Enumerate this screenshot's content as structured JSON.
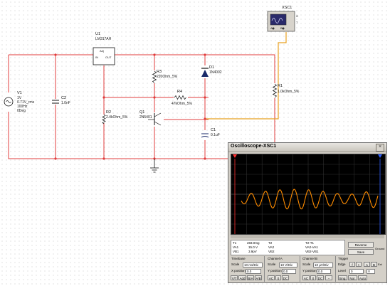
{
  "components": {
    "v1": {
      "ref": "V1",
      "l1": "1V",
      "l2": "0.71V_rms",
      "l3": "100Hz",
      "l4": "0Deg"
    },
    "c2": {
      "ref": "C2",
      "val": "1.0nF"
    },
    "u1": {
      "ref": "U1",
      "part": "LM317AH",
      "pin_adj": "Adj",
      "pin_in": "IN",
      "pin_out": "OUT"
    },
    "r3": {
      "ref": "R3",
      "val": "220Ohm_5%"
    },
    "r2": {
      "ref": "R2",
      "val": "2.4kOhm_5%"
    },
    "r4": {
      "ref": "R4",
      "val": "47kOhm_5%"
    },
    "d1": {
      "ref": "D1",
      "val": "1N4002"
    },
    "q1": {
      "ref": "Q1",
      "val": "2N5401"
    },
    "c1": {
      "ref": "C1",
      "val": "0.1uF"
    },
    "r1": {
      "ref": "R1",
      "val": "1.0kOhm_5%"
    },
    "xsc1": {
      "ref": "XSC1",
      "pins": [
        "A",
        "B"
      ],
      "right_pins": [
        "G",
        "T"
      ]
    }
  },
  "scope": {
    "title": "Oscilloscope-XSC1",
    "close": "×",
    "trace_color": "#ff8c00",
    "cursor_t1_color": "#ff3030",
    "cursor_t2_color": "#3060ff",
    "measure": {
      "t1_label": "T1",
      "t2_label": "T2",
      "t2t1_label": "T2-T1",
      "t1_values": [
        "283.0mg",
        "15.0 V",
        "3.9pV"
      ],
      "t1_rows": [
        "T1",
        "VA1",
        "VB1"
      ],
      "t2_rows": [
        "T2",
        "VA2",
        "VB2"
      ],
      "t2t1_rows": [
        "T2-T1",
        "VA2-VA1",
        "VB2-VB1"
      ]
    },
    "reverse_label": "Reverse",
    "save_label": "Save",
    "ground_label": "Ground",
    "timebase": {
      "heading": "Timebase",
      "scale_label": "Scale",
      "scale_value": "10 ms/Div",
      "xpos_label": "X position",
      "xpos_value": "0.0",
      "modes": [
        "Y/T",
        "Add",
        "B/A",
        "A/B"
      ]
    },
    "channel_a": {
      "heading": "Channel A",
      "scale_label": "Scale",
      "scale_value": "10 V/Div",
      "ypos_label": "Y position",
      "ypos_value": "0.0",
      "coupling": [
        "AC",
        "0",
        "DC"
      ]
    },
    "channel_b": {
      "heading": "Channel B",
      "scale_label": "Scale",
      "scale_value": "10 µV/Div",
      "ypos_label": "Y position",
      "ypos_value": "0.0",
      "coupling": [
        "AC",
        "0",
        "DC"
      ]
    },
    "trigger": {
      "heading": "Trigger",
      "edge_label": "Edge",
      "level_label": "Level",
      "level_value": "0",
      "unit": "V",
      "ext_label": "Ext",
      "modes": [
        "Sing.",
        "Nor.",
        "Auto"
      ]
    }
  }
}
